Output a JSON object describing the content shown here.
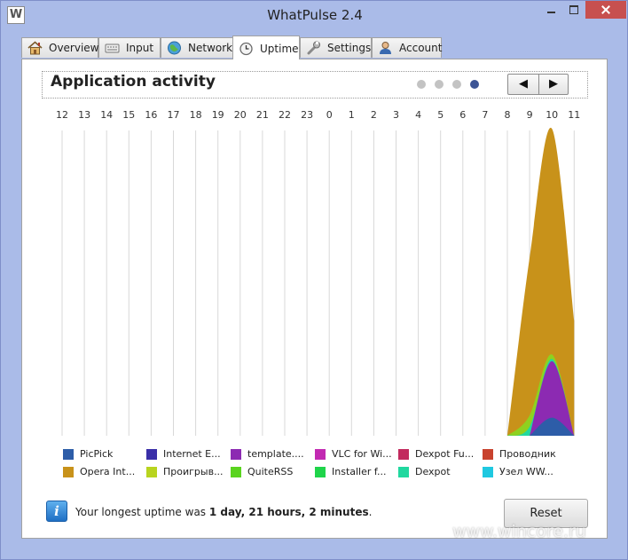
{
  "window": {
    "title": "WhatPulse 2.4",
    "app_icon_letter": "W"
  },
  "tabs": [
    {
      "label": "Overview",
      "icon": "house-icon",
      "active": false
    },
    {
      "label": "Input",
      "icon": "keyboard-icon",
      "active": false
    },
    {
      "label": "Network",
      "icon": "globe-icon",
      "active": false
    },
    {
      "label": "Uptime",
      "icon": "clock-icon",
      "active": true
    },
    {
      "label": "Settings",
      "icon": "wrench-icon",
      "active": false
    },
    {
      "label": "Account",
      "icon": "user-icon",
      "active": false
    }
  ],
  "header": {
    "title": "Application activity",
    "pager": {
      "count": 4,
      "active_index": 3
    },
    "prev_label": "◀",
    "next_label": "▶"
  },
  "chart_data": {
    "type": "area",
    "categories": [
      "12",
      "13",
      "14",
      "15",
      "16",
      "17",
      "18",
      "19",
      "20",
      "21",
      "22",
      "23",
      "0",
      "1",
      "2",
      "3",
      "4",
      "5",
      "6",
      "7",
      "8",
      "9",
      "10",
      "11"
    ],
    "stacked": true,
    "grid": "vertical",
    "series": [
      {
        "name": "Opera Int...",
        "color": "#c8921a",
        "values": [
          0,
          0,
          0,
          0,
          0,
          0,
          0,
          0,
          0,
          0,
          0,
          0,
          0,
          0,
          0,
          0,
          0,
          0,
          0,
          0,
          0,
          0.7,
          1.0,
          0.51
        ]
      },
      {
        "name": "Проигрыв...",
        "color": "#8fd11f",
        "values": [
          0,
          0,
          0,
          0,
          0,
          0,
          0,
          0,
          0,
          0,
          0,
          0,
          0,
          0,
          0,
          0,
          0,
          0,
          0,
          0,
          0,
          0.05,
          0.02,
          0
        ]
      },
      {
        "name": "Dexpot",
        "color": "#21d89f",
        "values": [
          0,
          0,
          0,
          0,
          0,
          0,
          0,
          0,
          0,
          0,
          0,
          0,
          0,
          0,
          0,
          0,
          0,
          0,
          0,
          0,
          0,
          0.04,
          0.01,
          0
        ]
      },
      {
        "name": "template....",
        "color": "#8c2ab2",
        "values": [
          0,
          0,
          0,
          0,
          0,
          0,
          0,
          0,
          0,
          0,
          0,
          0,
          0,
          0,
          0,
          0,
          0,
          0,
          0,
          0,
          0,
          0,
          0.25,
          0
        ]
      },
      {
        "name": "PicPick",
        "color": "#2d5da8",
        "values": [
          0,
          0,
          0,
          0,
          0,
          0,
          0,
          0,
          0,
          0,
          0,
          0,
          0,
          0,
          0,
          0,
          0,
          0,
          0,
          0,
          0,
          0,
          0.08,
          0
        ]
      }
    ],
    "legend": [
      {
        "name": "PicPick",
        "color": "#2d5da8"
      },
      {
        "name": "Internet E...",
        "color": "#3a2fa8"
      },
      {
        "name": "template....",
        "color": "#8c2ab2"
      },
      {
        "name": "VLC for Wi...",
        "color": "#c22ab2"
      },
      {
        "name": "Dexpot Fu...",
        "color": "#c22a5e"
      },
      {
        "name": "Проводник",
        "color": "#c8422e"
      },
      {
        "name": "Opera Int...",
        "color": "#c8921a"
      },
      {
        "name": "Проигрыв...",
        "color": "#b8d41f"
      },
      {
        "name": "QuiteRSS",
        "color": "#5ad41f"
      },
      {
        "name": "Installer f...",
        "color": "#1fd44a"
      },
      {
        "name": "Dexpot",
        "color": "#21d89f"
      },
      {
        "name": "Узел WW...",
        "color": "#1fc8e0"
      }
    ]
  },
  "footer": {
    "uptime_prefix": "Your longest uptime was ",
    "uptime_value": "1 day, 21 hours, 2 minutes",
    "uptime_suffix": ".",
    "reset_label": "Reset"
  },
  "watermark": "www.wincore.ru"
}
